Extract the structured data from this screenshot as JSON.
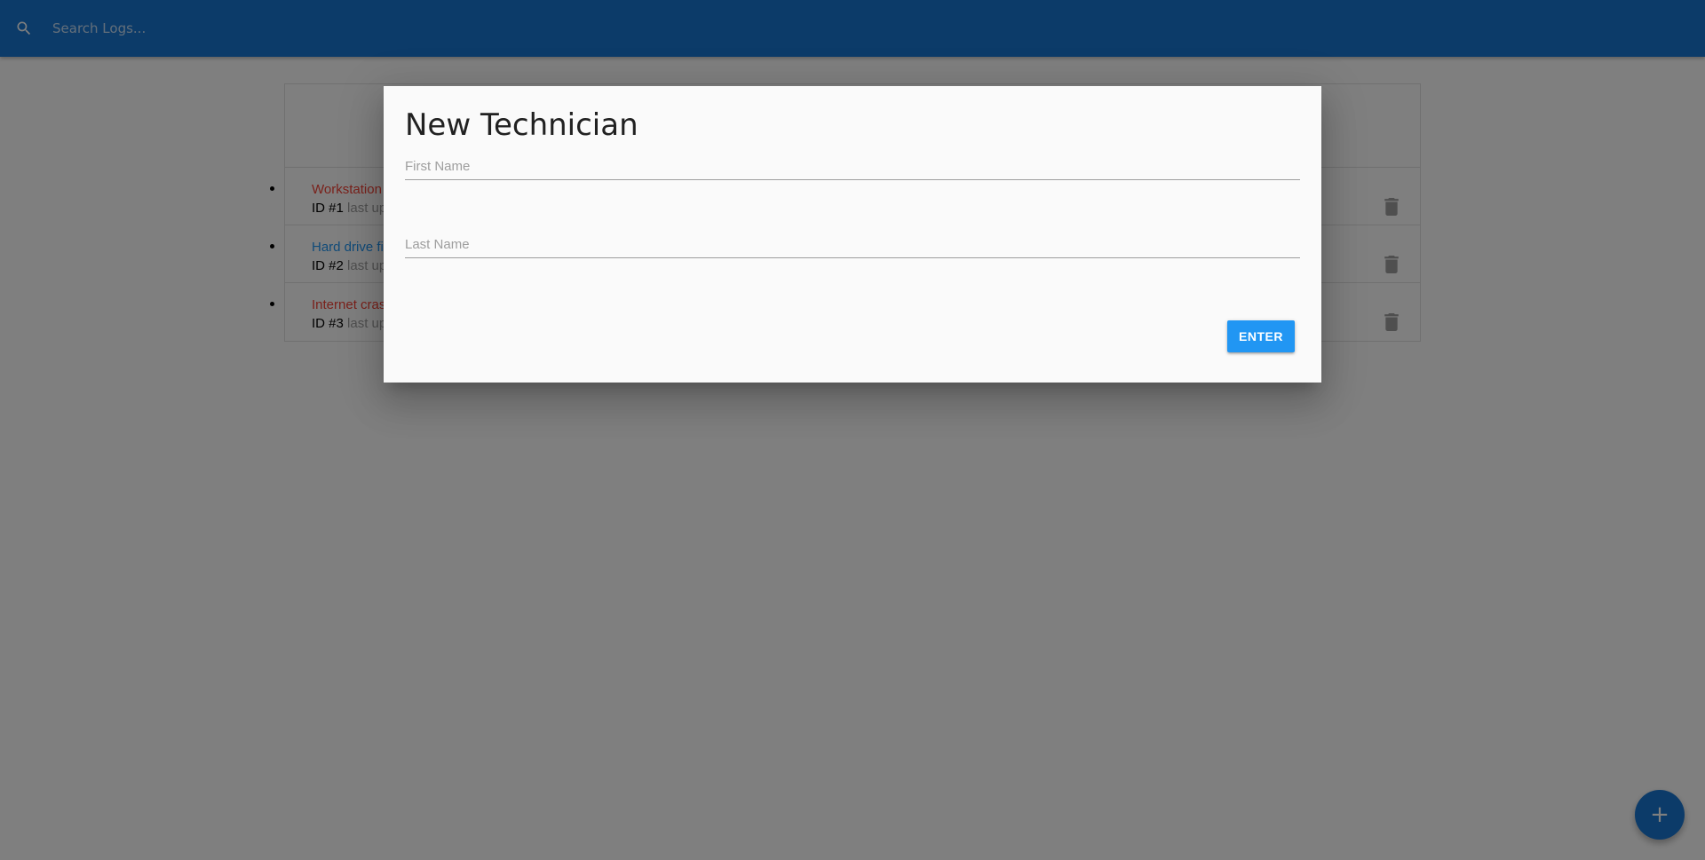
{
  "navbar": {
    "search_icon": "search-icon",
    "search_placeholder": "Search Logs..."
  },
  "logs": [
    {
      "message": "Workstation",
      "id_label": "ID #1",
      "meta": "last up",
      "color": "#f44336"
    },
    {
      "message": "Hard drive fi",
      "id_label": "ID #2",
      "meta": "last up",
      "color": "#2196f3"
    },
    {
      "message": "Internet cras",
      "id_label": "ID #3",
      "meta": "last up",
      "color": "#f44336"
    }
  ],
  "modal": {
    "title": "New Technician",
    "first_name_placeholder": "First Name",
    "last_name_placeholder": "Last Name",
    "enter_label": "ENTER"
  },
  "fab": {
    "label": "+",
    "icon": "plus-icon"
  },
  "colors": {
    "primary": "#1976d2",
    "accent": "#2196f3",
    "danger": "#f44336"
  }
}
